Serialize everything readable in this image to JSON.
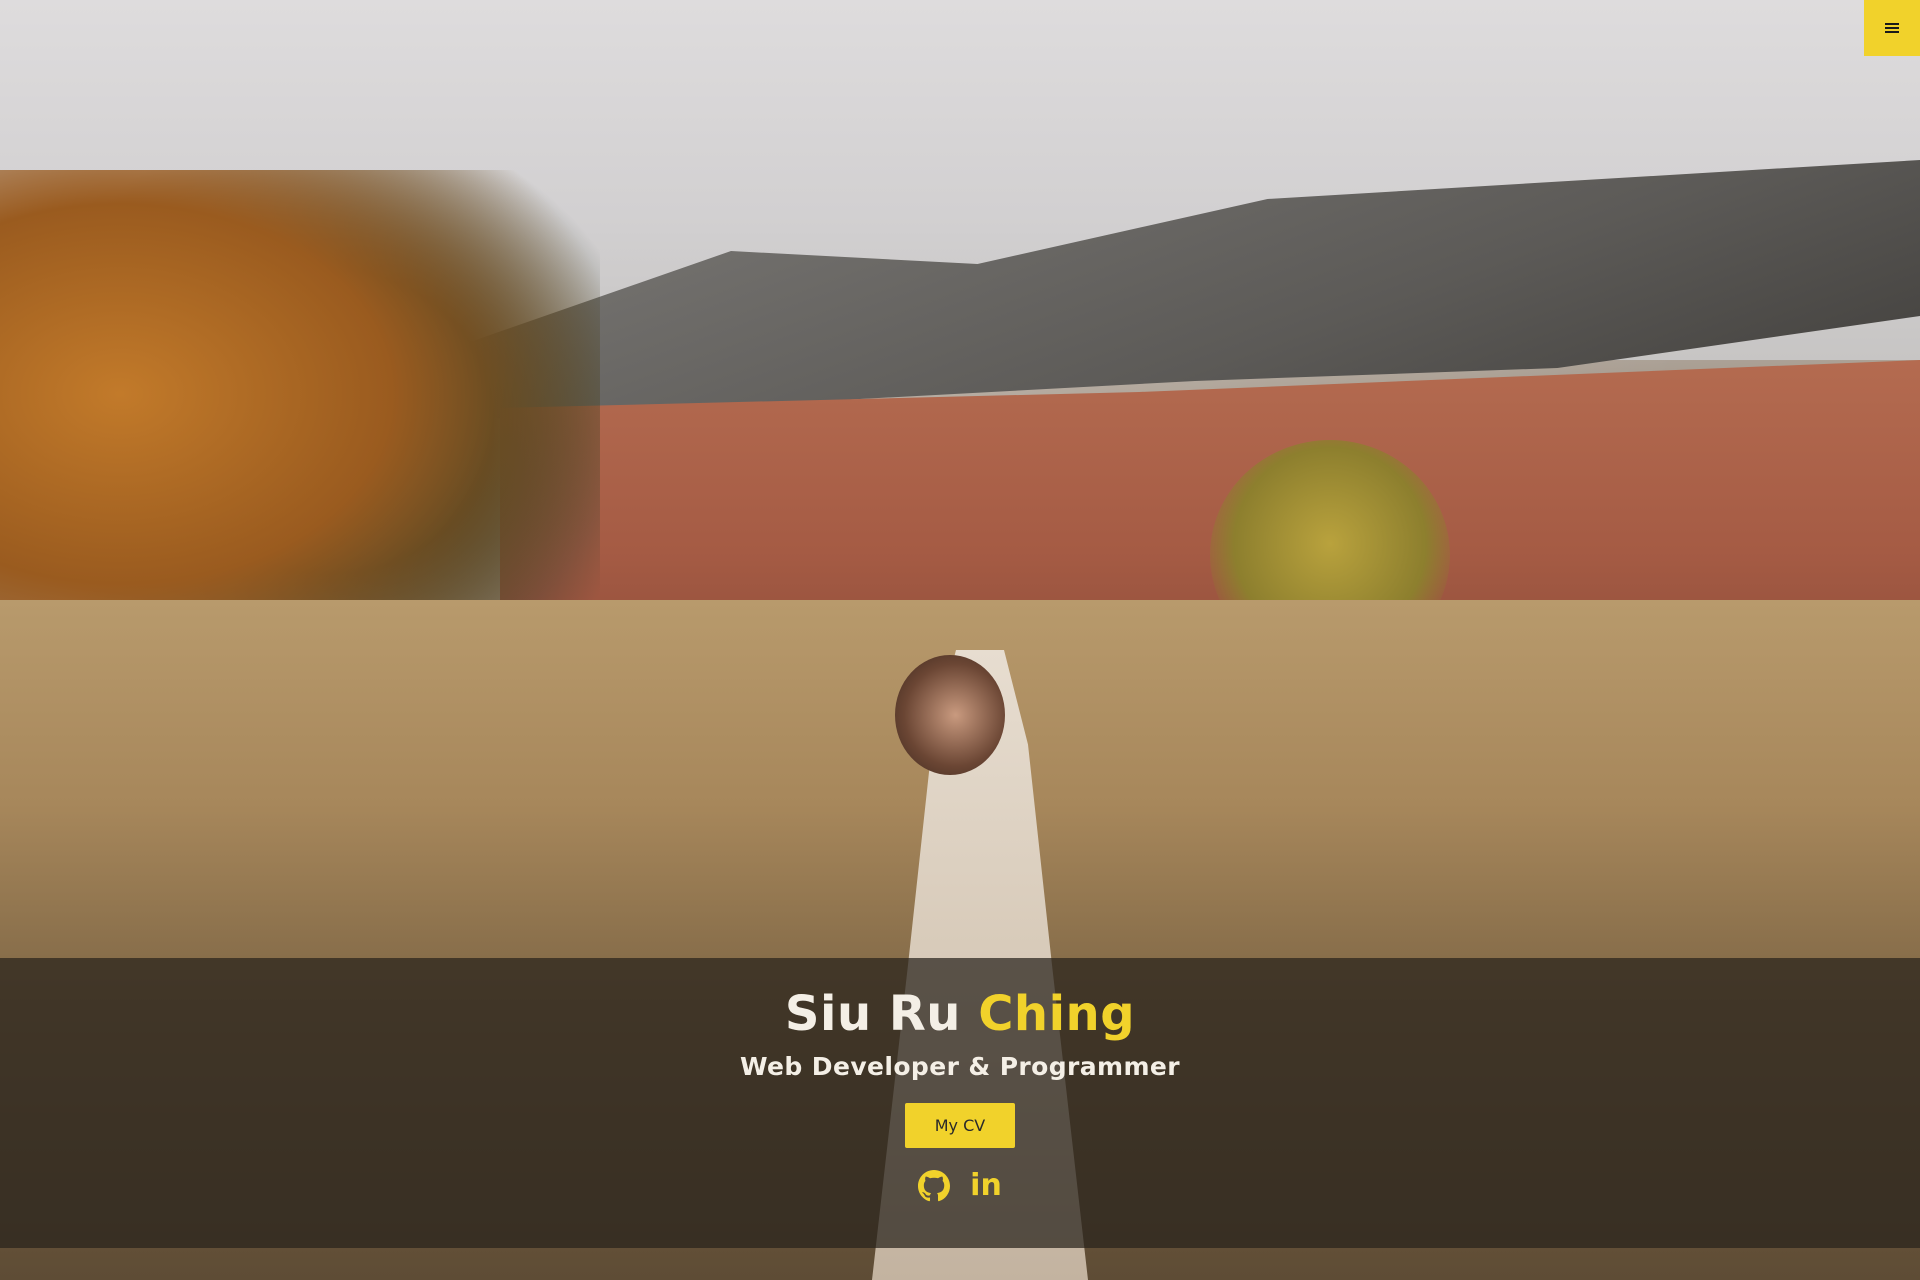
{
  "menu": {
    "icon": "hamburger-menu-icon"
  },
  "hero": {
    "first_name": "Siu Ru",
    "last_name": "Ching",
    "tagline": "Web Developer & Programmer",
    "cv_button_label": "My CV",
    "socials": [
      {
        "icon": "github-icon"
      },
      {
        "icon": "linkedin-icon",
        "text": "in"
      }
    ]
  },
  "colors": {
    "accent": "#f1d22b",
    "overlay": "#28221c",
    "text": "#f4efe6"
  }
}
